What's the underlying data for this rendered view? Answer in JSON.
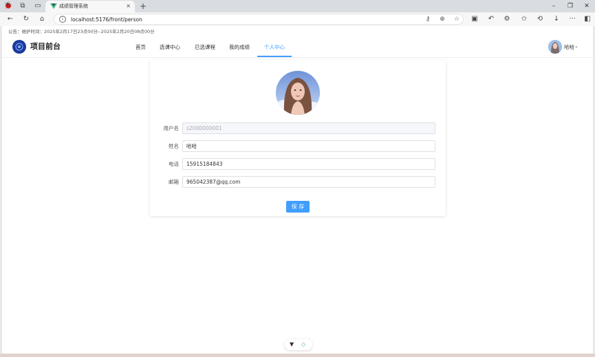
{
  "browser": {
    "tab_title": "成绩管理系统",
    "tab_close": "×",
    "new_tab": "+",
    "url": "localhost:5176/front/person",
    "window_controls": [
      "–",
      "❐",
      "✕"
    ]
  },
  "page": {
    "notice": "公告：维护时间：2025年2月17日23点00分--2025年2月20日08点00分",
    "brand": "项目前台",
    "nav": [
      {
        "label": "首页",
        "active": false
      },
      {
        "label": "选课中心",
        "active": false
      },
      {
        "label": "已选课程",
        "active": false
      },
      {
        "label": "我的成绩",
        "active": false
      },
      {
        "label": "个人中心",
        "active": true
      }
    ],
    "user": {
      "name": "哈哈",
      "caret": "⌄"
    },
    "accent_color": "#409eff"
  },
  "profile": {
    "fields": [
      {
        "label": "用户名",
        "value": "s2000000001",
        "disabled": true
      },
      {
        "label": "姓名",
        "value": "哈哈",
        "disabled": false
      },
      {
        "label": "电话",
        "value": "15915184843",
        "disabled": false
      },
      {
        "label": "邮箱",
        "value": "965042387@qq.com",
        "disabled": false
      }
    ],
    "save_label": "保 存"
  },
  "icons": {
    "back": "←",
    "refresh": "↻",
    "home": "⌂",
    "star": "☆",
    "more": "···",
    "download": "↓",
    "history": "⟲",
    "floatbar_arrow": "▼",
    "floatbar_vue": "◇"
  }
}
